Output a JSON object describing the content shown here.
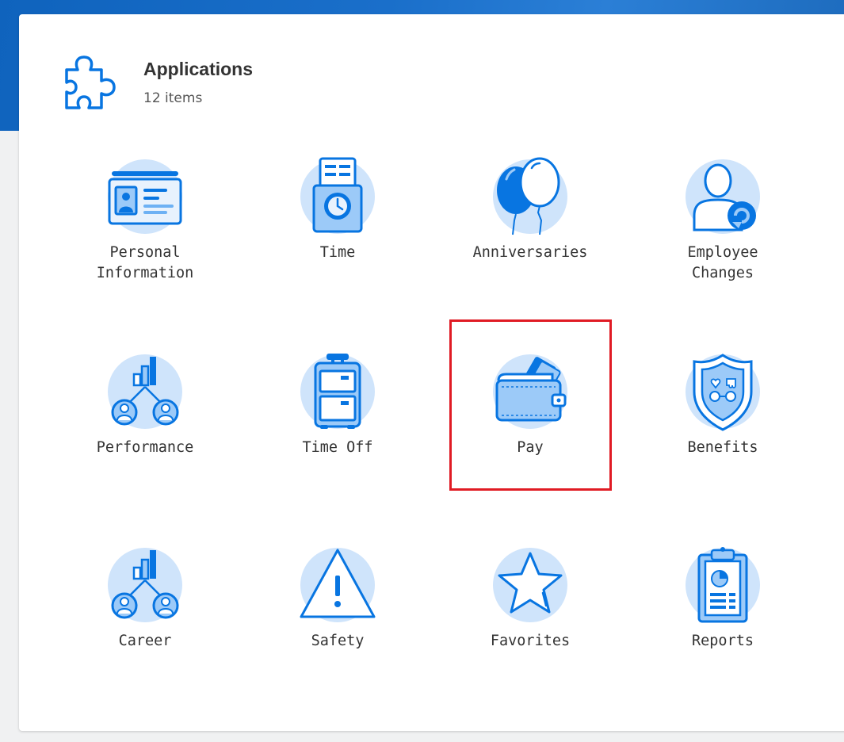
{
  "header": {
    "title": "Applications",
    "count_label": "12 items",
    "icon": "puzzle-piece-icon"
  },
  "apps": [
    {
      "label": "Personal\nInformation",
      "icon": "id-card-icon"
    },
    {
      "label": "Time",
      "icon": "time-clock-icon"
    },
    {
      "label": "Anniversaries",
      "icon": "balloons-icon"
    },
    {
      "label": "Employee\nChanges",
      "icon": "employee-change-icon"
    },
    {
      "label": "Performance",
      "icon": "performance-chart-icon"
    },
    {
      "label": "Time Off",
      "icon": "suitcase-icon"
    },
    {
      "label": "Pay",
      "icon": "wallet-icon"
    },
    {
      "label": "Benefits",
      "icon": "benefits-shield-icon"
    },
    {
      "label": "Career",
      "icon": "career-chart-icon"
    },
    {
      "label": "Safety",
      "icon": "warning-triangle-icon"
    },
    {
      "label": "Favorites",
      "icon": "star-icon"
    },
    {
      "label": "Reports",
      "icon": "clipboard-report-icon"
    }
  ],
  "colors": {
    "primary": "#0875e1",
    "icon_circle": "#cfe4fb",
    "icon_fill": "#9ccaf8",
    "highlight": "#e01b24"
  }
}
